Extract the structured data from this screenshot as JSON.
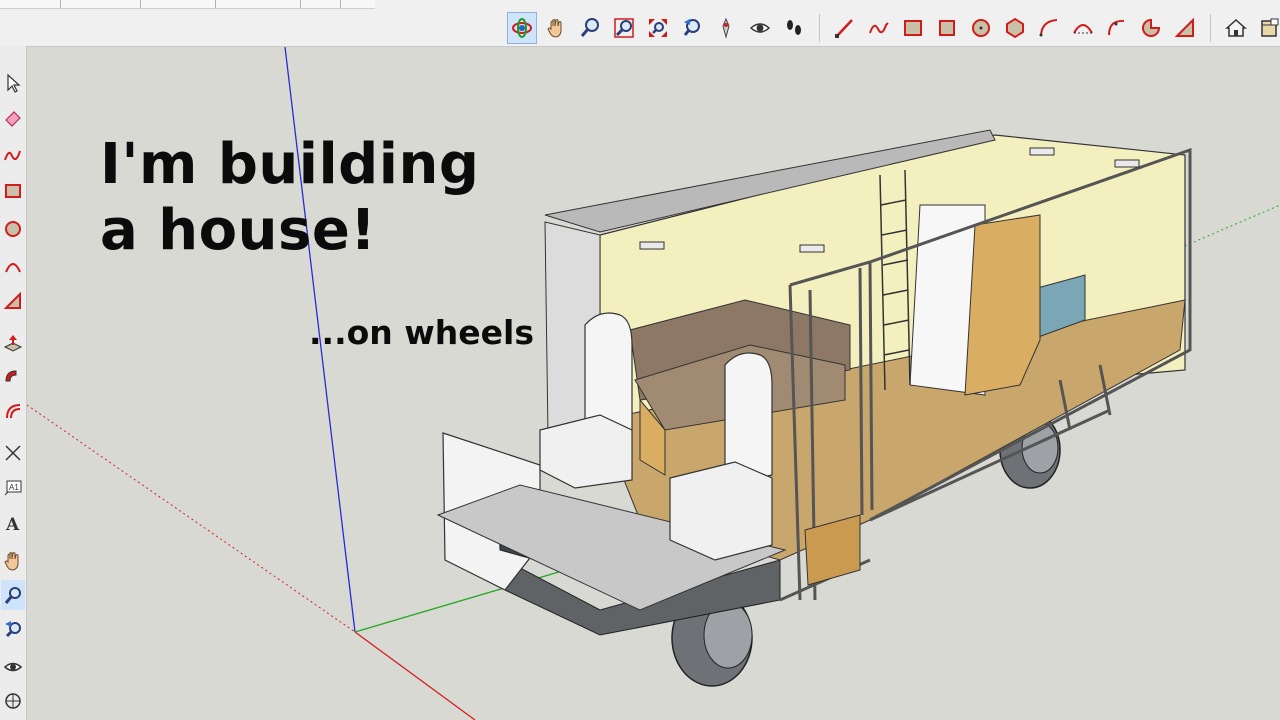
{
  "overlay": {
    "title_line1": "I'm building",
    "title_line2": "a house!",
    "subtitle": "...on wheels"
  },
  "toolbar": {
    "tools": [
      {
        "name": "orbit-icon",
        "active": true
      },
      {
        "name": "pan-icon"
      },
      {
        "name": "zoom-icon"
      },
      {
        "name": "zoom-window-icon"
      },
      {
        "name": "zoom-extents-icon"
      },
      {
        "name": "previous-view-icon"
      },
      {
        "name": "position-camera-icon"
      },
      {
        "name": "look-around-icon"
      },
      {
        "name": "walk-icon"
      },
      {
        "name": "line-icon"
      },
      {
        "name": "freehand-icon"
      },
      {
        "name": "rectangle-icon"
      },
      {
        "name": "rotated-rectangle-icon"
      },
      {
        "name": "circle-icon"
      },
      {
        "name": "polygon-icon"
      },
      {
        "name": "arc-icon"
      },
      {
        "name": "two-point-arc-icon"
      },
      {
        "name": "three-point-arc-icon"
      },
      {
        "name": "pie-icon"
      },
      {
        "name": "warehouse-icon"
      },
      {
        "name": "components-icon"
      }
    ]
  },
  "left_toolbar": {
    "tools": [
      {
        "name": "select-icon"
      },
      {
        "name": "eraser-icon"
      },
      {
        "name": "freehand-icon"
      },
      {
        "name": "rectangle-icon"
      },
      {
        "name": "circle-icon"
      },
      {
        "name": "arc-icon"
      },
      {
        "name": "pie-icon"
      },
      {
        "name": "push-pull-icon"
      },
      {
        "name": "follow-me-icon"
      },
      {
        "name": "offset-icon"
      },
      {
        "name": "tape-measure-icon"
      },
      {
        "name": "text-icon",
        "label": "A1"
      },
      {
        "name": "3d-text-icon",
        "label": "A"
      },
      {
        "name": "pan-icon"
      },
      {
        "name": "zoom-icon",
        "active": true
      },
      {
        "name": "previous-view-icon"
      },
      {
        "name": "look-around-icon"
      },
      {
        "name": "section-plane-icon"
      }
    ]
  },
  "colors": {
    "viewport_bg": "#d9d9d4",
    "axis_blue": "#2a2ad6",
    "axis_green": "#23a81f",
    "axis_red": "#d52020",
    "wall_cream": "#f4efbe",
    "wood_floor": "#c9a66b",
    "upholstery": "#8c7864",
    "mattress_blue": "#7aa6b6"
  }
}
